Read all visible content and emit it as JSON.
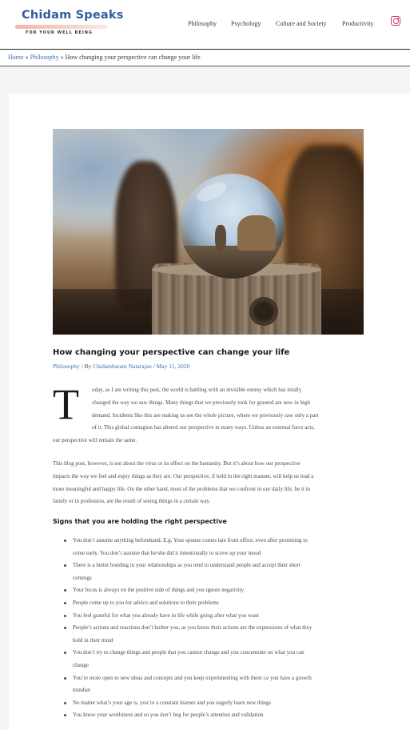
{
  "header": {
    "logo_title": "Chidam Speaks",
    "logo_tagline": "FOR YOUR WELL BEING",
    "nav": [
      "Philosophy",
      "Psychology",
      "Culture and Society",
      "Productivity"
    ],
    "social_icon": "instagram-icon",
    "accent_color": "#2f5d9e",
    "instagram_color": "#d6336c"
  },
  "breadcrumb": {
    "home": "Home",
    "sep": "»",
    "category": "Philosophy",
    "current": "How changing your perspective can change your life"
  },
  "post": {
    "title": "How changing your perspective can change your life",
    "category": "Philosophy",
    "by": "/ By",
    "author": "Chidambaram Natarajan",
    "date_sep": "/",
    "date": "May 11, 2020",
    "dropcap": "T",
    "p1_lines": [
      "oday, as I am writing this post, the world is battling with an invisible enemy which has totally",
      "changed the way we saw things. Many things that we previously took for granted are now in high",
      "demand. Incidents like this are making us see the whole picture, where we previously saw only a part",
      "of it. This global contagion has altered our perspective in many ways. Unless an external force acts,",
      "our perspective will remain the same."
    ],
    "p2_lines": [
      "This blog post, however, is not about the virus or its effect on the humanity. But it’s about how our perspective",
      "impacts the way we feel and enjoy things as they are. Our perspective, if held in the right manner, will help us lead a",
      "more meaningful and happy life. On the other hand, most of the problems that we confront in our daily life, be it in",
      "family or in profession, are the result of seeing things in a certain way."
    ],
    "signs_heading": "Signs that you are holding the right perspective",
    "signs": [
      [
        "You don’t assume anything beforehand. E.g. Your spouse comes late from office, even after promising to",
        "come early. You don’t assume that he/she did it intentionally to screw up your mood"
      ],
      [
        "There is a better bonding in your relationships as you tend to understand people and accept their short",
        "comings"
      ],
      [
        "Your focus is always on the positive side of things and you ignore negativity"
      ],
      [
        "People come up to you for advice and solutions to their problems"
      ],
      [
        "You feel grateful for what you already have in life while going after what you want"
      ],
      [
        "People’s actions and reactions don’t bother you, as you know their actions are the expressions of what they",
        "hold in their mind"
      ],
      [
        "You don’t try to change things and people that you cannot change and you concentrate on what you can",
        "change"
      ],
      [
        "You’re more open to new ideas and concepts and you keep experimenting with them i.e you have a growth",
        "mindset"
      ],
      [
        "No matter what’s your age is, you’re a constant learner and you eagerly learn new things"
      ],
      [
        "You know your worthiness and so you don’t beg for people’s attention and validation"
      ]
    ]
  }
}
